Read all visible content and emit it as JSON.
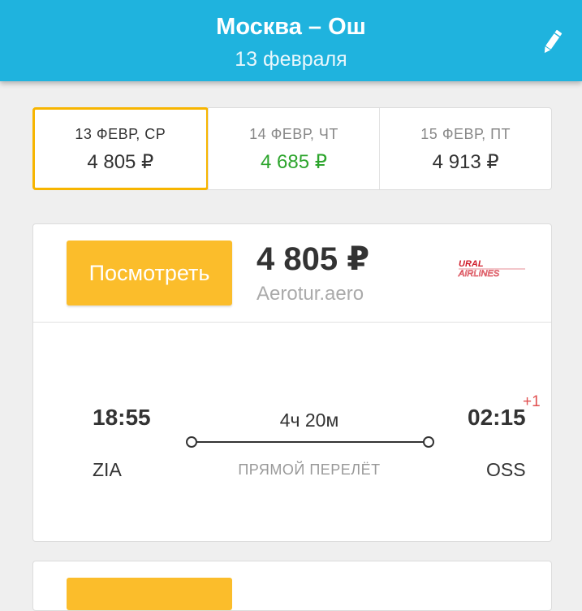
{
  "header": {
    "title": "Москва – Ош",
    "subtitle": "13 февраля",
    "edit_icon": "pencil-icon",
    "background": "#1fb3de"
  },
  "dates": [
    {
      "label": "13 ФЕВР, СР",
      "price": "4 805 ₽",
      "selected": true,
      "cheapest": false
    },
    {
      "label": "14 ФЕВР, ЧТ",
      "price": "4 685 ₽",
      "selected": false,
      "cheapest": true
    },
    {
      "label": "15 ФЕВР, ПТ",
      "price": "4 913 ₽",
      "selected": false,
      "cheapest": false
    }
  ],
  "offer": {
    "button_label": "Посмотреть",
    "price": "4 805 ₽",
    "agent": "Aerotur.aero",
    "airline_logo": {
      "line1": "URAL",
      "line2": "AIRLINES"
    },
    "departure": {
      "time": "18:55",
      "code": "ZIA"
    },
    "arrival": {
      "time": "02:15",
      "code": "OSS",
      "day_offset": "+1"
    },
    "duration": "4ч 20м",
    "flight_type": "ПРЯМОЙ ПЕРЕЛЁТ"
  },
  "colors": {
    "accent": "#fbbd2b",
    "selected_border": "#f7b500",
    "cheap_price": "#2da52d",
    "day_offset": "#e05050"
  }
}
